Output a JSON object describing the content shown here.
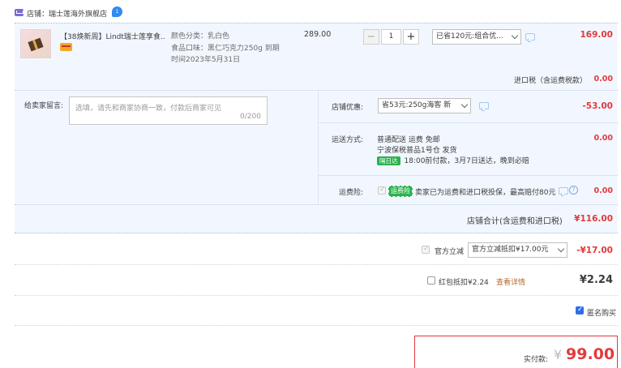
{
  "shop": {
    "label": "店铺：瑞士莲海外旗舰店",
    "badge": "1"
  },
  "item": {
    "title": "【38焕新周】Lindt瑞士莲享食...",
    "sku_color": "颜色分类：乳白色",
    "sku_flavor": "食品口味：黑仁巧克力250g 到期",
    "sku_date": "时间2023年5月31日",
    "unit_price": "289.00",
    "quantity": "1",
    "minus": "−",
    "plus": "+",
    "discount_option": "已省120元:组合优...",
    "total": "169.00"
  },
  "tax": {
    "label": "进口税（含运费税款）",
    "value": "0.00"
  },
  "message": {
    "label": "给卖家留言:",
    "placeholder": "选填，请先和商家协商一致，付款后商家可见",
    "count": "0/200"
  },
  "coupon": {
    "label": "店铺优惠:",
    "option": "省53元:250g海客 新",
    "value": "-53.00"
  },
  "shipping": {
    "label": "运送方式:",
    "line1": "普通配送 运费 免邮",
    "line2": "宁波保税普品1号仓  发货",
    "badge": "隔日达",
    "line3": "18:00前付款，3月7日送达，晚到必赔",
    "value": "0.00"
  },
  "insurance": {
    "label": "运费险:",
    "badge": "运费险",
    "text": "卖家已为运费和进口税投保，最高赔付80元",
    "help": "?",
    "value": "0.00"
  },
  "store_total": {
    "label": "店铺合计(含运费和进口税)",
    "value": "¥116.00"
  },
  "official_discount": {
    "label": "官方立减",
    "option": "官方立减抵扣¥17.00元",
    "value": "-¥17.00"
  },
  "red_packet": {
    "label": "红包抵扣¥2.24",
    "link": "查看详情",
    "value": "¥2.24"
  },
  "anonymous": {
    "label": "匿名购买"
  },
  "payment": {
    "label": "实付款:",
    "currency": "¥",
    "value": "99.00"
  },
  "colors": {
    "accent_red": "#e4393c",
    "panel_blue": "#f2f7ff",
    "badge_green": "#2bb24c",
    "checkbox_blue": "#2d6ee6"
  }
}
